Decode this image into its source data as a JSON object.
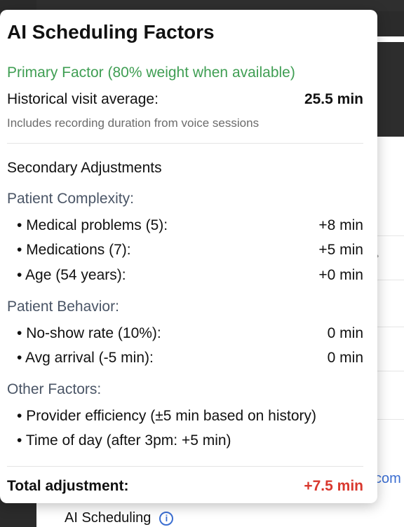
{
  "background": {
    "link_fragment": "com",
    "label": "AI Scheduling",
    "info_glyph": "i"
  },
  "popover": {
    "title": "AI Scheduling Factors",
    "primary_factor": "Primary Factor (80% weight when available)",
    "historical": {
      "label": "Historical visit average:",
      "value": "25.5 min"
    },
    "note": "Includes recording duration from voice sessions",
    "secondary_title": "Secondary Adjustments",
    "patient_complexity": {
      "title": "Patient Complexity:",
      "items": [
        {
          "label": "Medical problems (5):",
          "value": "+8 min"
        },
        {
          "label": "Medications (7):",
          "value": "+5 min"
        },
        {
          "label": "Age (54 years):",
          "value": "+0 min"
        }
      ]
    },
    "patient_behavior": {
      "title": "Patient Behavior:",
      "items": [
        {
          "label": "No-show rate (10%):",
          "value": "0 min"
        },
        {
          "label": "Avg arrival (-5 min):",
          "value": "0 min"
        }
      ]
    },
    "other_factors": {
      "title": "Other Factors:",
      "items": [
        {
          "label": "Provider efficiency (±5 min based on history)"
        },
        {
          "label": "Time of day (after 3pm: +5 min)"
        }
      ]
    },
    "total": {
      "label": "Total adjustment:",
      "value": "+7.5 min"
    }
  },
  "colors": {
    "primary_green": "#3f9e53",
    "total_red": "#d9382e",
    "link_blue": "#3b6ed1"
  }
}
